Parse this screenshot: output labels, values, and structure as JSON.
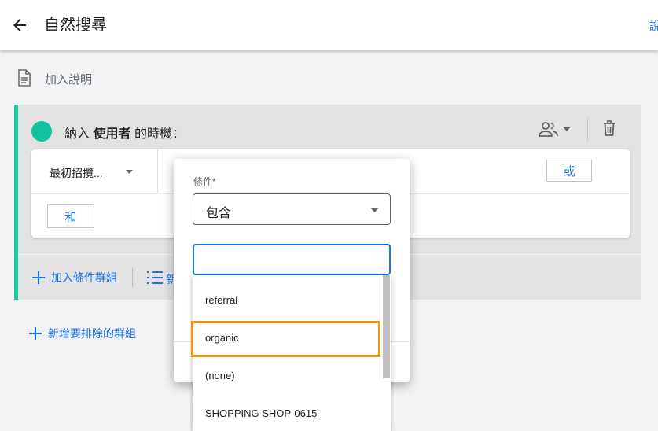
{
  "header": {
    "title": "自然搜尋",
    "right_link": "說"
  },
  "description": {
    "label": "加入說明"
  },
  "group": {
    "include_prefix": "納入",
    "include_subject": "使用者",
    "include_suffix": "的時機：",
    "dimension_label": "最初招攬...",
    "or_label": "或",
    "and_label": "和",
    "add_condition_group": "加入條件群組",
    "add_sequence_cut": "新"
  },
  "add_exclude_group": "新增要排除的群組",
  "dialog": {
    "condition_label": "條件*",
    "condition_value": "包含",
    "search_value": "",
    "options": [
      "referral",
      "organic",
      "(none)",
      "SHOPPING SHOP-0615"
    ]
  },
  "colors": {
    "accent": "#1a73e8",
    "group_accent": "#1ec8a5",
    "highlight": "#f29111"
  }
}
